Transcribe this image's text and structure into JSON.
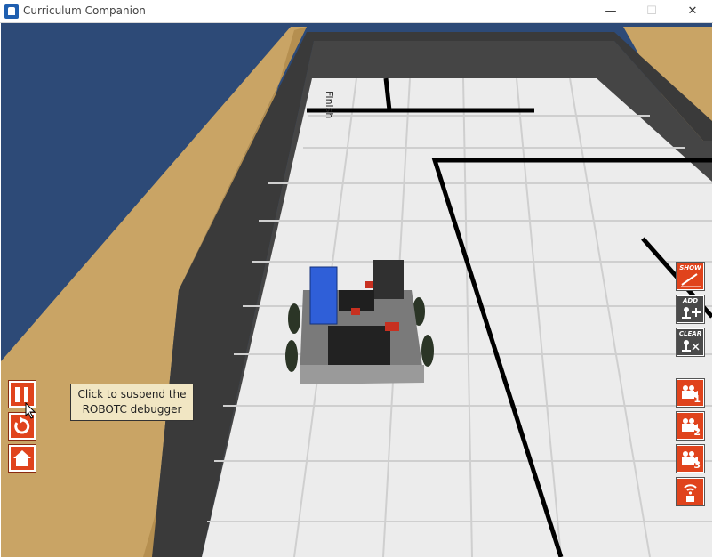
{
  "window": {
    "title": "Curriculum Companion",
    "minimize": "—",
    "maximize": "☐",
    "close": "✕"
  },
  "scene": {
    "finish_label": "Finish"
  },
  "tooltip": {
    "line1": "Click to suspend the",
    "line2": "ROBOTC debugger"
  },
  "side_buttons": {
    "show": "SHOW",
    "add": "ADD",
    "clear": "CLEAR",
    "cam1": "1",
    "cam2": "2",
    "cam3": "3"
  },
  "colors": {
    "accent": "#e0431c",
    "sky": "#2d4a77",
    "wall_wood": "#c9a465",
    "floor": "#ececec"
  }
}
